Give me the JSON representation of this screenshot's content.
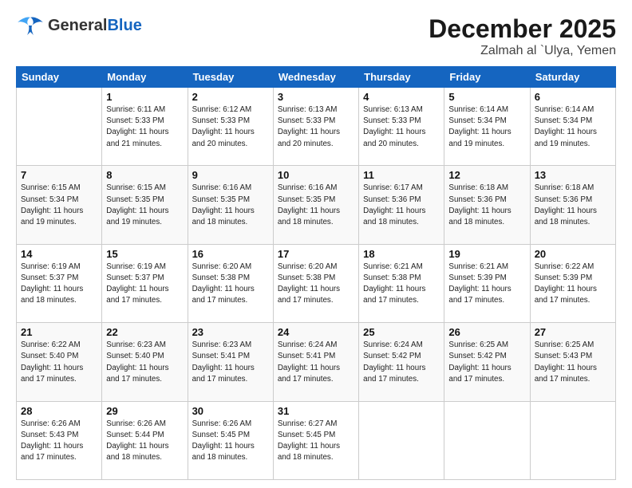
{
  "header": {
    "logo_general": "General",
    "logo_blue": "Blue",
    "month": "December 2025",
    "location": "Zalmah al `Ulya, Yemen"
  },
  "weekdays": [
    "Sunday",
    "Monday",
    "Tuesday",
    "Wednesday",
    "Thursday",
    "Friday",
    "Saturday"
  ],
  "weeks": [
    [
      {
        "day": "",
        "info": ""
      },
      {
        "day": "1",
        "info": "Sunrise: 6:11 AM\nSunset: 5:33 PM\nDaylight: 11 hours\nand 21 minutes."
      },
      {
        "day": "2",
        "info": "Sunrise: 6:12 AM\nSunset: 5:33 PM\nDaylight: 11 hours\nand 20 minutes."
      },
      {
        "day": "3",
        "info": "Sunrise: 6:13 AM\nSunset: 5:33 PM\nDaylight: 11 hours\nand 20 minutes."
      },
      {
        "day": "4",
        "info": "Sunrise: 6:13 AM\nSunset: 5:33 PM\nDaylight: 11 hours\nand 20 minutes."
      },
      {
        "day": "5",
        "info": "Sunrise: 6:14 AM\nSunset: 5:34 PM\nDaylight: 11 hours\nand 19 minutes."
      },
      {
        "day": "6",
        "info": "Sunrise: 6:14 AM\nSunset: 5:34 PM\nDaylight: 11 hours\nand 19 minutes."
      }
    ],
    [
      {
        "day": "7",
        "info": "Sunrise: 6:15 AM\nSunset: 5:34 PM\nDaylight: 11 hours\nand 19 minutes."
      },
      {
        "day": "8",
        "info": "Sunrise: 6:15 AM\nSunset: 5:35 PM\nDaylight: 11 hours\nand 19 minutes."
      },
      {
        "day": "9",
        "info": "Sunrise: 6:16 AM\nSunset: 5:35 PM\nDaylight: 11 hours\nand 18 minutes."
      },
      {
        "day": "10",
        "info": "Sunrise: 6:16 AM\nSunset: 5:35 PM\nDaylight: 11 hours\nand 18 minutes."
      },
      {
        "day": "11",
        "info": "Sunrise: 6:17 AM\nSunset: 5:36 PM\nDaylight: 11 hours\nand 18 minutes."
      },
      {
        "day": "12",
        "info": "Sunrise: 6:18 AM\nSunset: 5:36 PM\nDaylight: 11 hours\nand 18 minutes."
      },
      {
        "day": "13",
        "info": "Sunrise: 6:18 AM\nSunset: 5:36 PM\nDaylight: 11 hours\nand 18 minutes."
      }
    ],
    [
      {
        "day": "14",
        "info": "Sunrise: 6:19 AM\nSunset: 5:37 PM\nDaylight: 11 hours\nand 18 minutes."
      },
      {
        "day": "15",
        "info": "Sunrise: 6:19 AM\nSunset: 5:37 PM\nDaylight: 11 hours\nand 17 minutes."
      },
      {
        "day": "16",
        "info": "Sunrise: 6:20 AM\nSunset: 5:38 PM\nDaylight: 11 hours\nand 17 minutes."
      },
      {
        "day": "17",
        "info": "Sunrise: 6:20 AM\nSunset: 5:38 PM\nDaylight: 11 hours\nand 17 minutes."
      },
      {
        "day": "18",
        "info": "Sunrise: 6:21 AM\nSunset: 5:38 PM\nDaylight: 11 hours\nand 17 minutes."
      },
      {
        "day": "19",
        "info": "Sunrise: 6:21 AM\nSunset: 5:39 PM\nDaylight: 11 hours\nand 17 minutes."
      },
      {
        "day": "20",
        "info": "Sunrise: 6:22 AM\nSunset: 5:39 PM\nDaylight: 11 hours\nand 17 minutes."
      }
    ],
    [
      {
        "day": "21",
        "info": "Sunrise: 6:22 AM\nSunset: 5:40 PM\nDaylight: 11 hours\nand 17 minutes."
      },
      {
        "day": "22",
        "info": "Sunrise: 6:23 AM\nSunset: 5:40 PM\nDaylight: 11 hours\nand 17 minutes."
      },
      {
        "day": "23",
        "info": "Sunrise: 6:23 AM\nSunset: 5:41 PM\nDaylight: 11 hours\nand 17 minutes."
      },
      {
        "day": "24",
        "info": "Sunrise: 6:24 AM\nSunset: 5:41 PM\nDaylight: 11 hours\nand 17 minutes."
      },
      {
        "day": "25",
        "info": "Sunrise: 6:24 AM\nSunset: 5:42 PM\nDaylight: 11 hours\nand 17 minutes."
      },
      {
        "day": "26",
        "info": "Sunrise: 6:25 AM\nSunset: 5:42 PM\nDaylight: 11 hours\nand 17 minutes."
      },
      {
        "day": "27",
        "info": "Sunrise: 6:25 AM\nSunset: 5:43 PM\nDaylight: 11 hours\nand 17 minutes."
      }
    ],
    [
      {
        "day": "28",
        "info": "Sunrise: 6:26 AM\nSunset: 5:43 PM\nDaylight: 11 hours\nand 17 minutes."
      },
      {
        "day": "29",
        "info": "Sunrise: 6:26 AM\nSunset: 5:44 PM\nDaylight: 11 hours\nand 18 minutes."
      },
      {
        "day": "30",
        "info": "Sunrise: 6:26 AM\nSunset: 5:45 PM\nDaylight: 11 hours\nand 18 minutes."
      },
      {
        "day": "31",
        "info": "Sunrise: 6:27 AM\nSunset: 5:45 PM\nDaylight: 11 hours\nand 18 minutes."
      },
      {
        "day": "",
        "info": ""
      },
      {
        "day": "",
        "info": ""
      },
      {
        "day": "",
        "info": ""
      }
    ]
  ]
}
